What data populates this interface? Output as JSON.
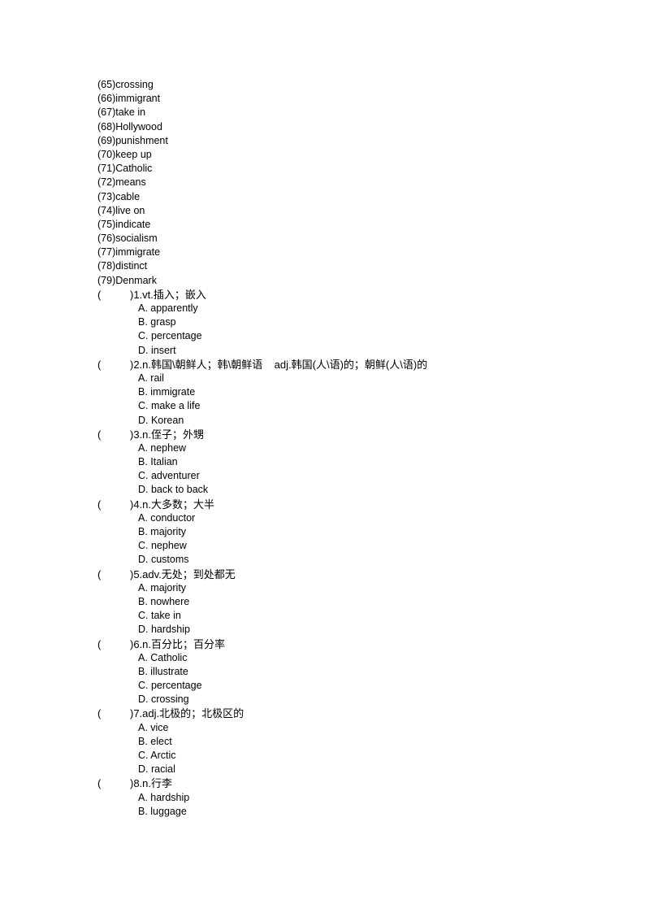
{
  "vocab_list": [
    {
      "num": "(65)",
      "word": "crossing"
    },
    {
      "num": "(66)",
      "word": "immigrant"
    },
    {
      "num": "(67)",
      "word": "take in"
    },
    {
      "num": "(68)",
      "word": "Hollywood"
    },
    {
      "num": "(69)",
      "word": "punishment"
    },
    {
      "num": "(70)",
      "word": "keep up"
    },
    {
      "num": "(71)",
      "word": "Catholic"
    },
    {
      "num": "(72)",
      "word": "means"
    },
    {
      "num": "(73)",
      "word": "cable"
    },
    {
      "num": "(74)",
      "word": "live on"
    },
    {
      "num": "(75)",
      "word": "indicate"
    },
    {
      "num": "(76)",
      "word": "socialism"
    },
    {
      "num": "(77)",
      "word": "immigrate"
    },
    {
      "num": "(78)",
      "word": "distinct"
    },
    {
      "num": "(79)",
      "word": "Denmark"
    }
  ],
  "questions": [
    {
      "open_paren": "(",
      "prompt": ")1.vt.插入；嵌入",
      "options": [
        "A. apparently",
        "B. grasp",
        "C. percentage",
        "D. insert"
      ]
    },
    {
      "open_paren": "(",
      "prompt": ")2.n.韩国\\朝鲜人；韩\\朝鲜语    adj.韩国(人\\语)的；朝鲜(人\\语)的",
      "options": [
        "A. rail",
        "B. immigrate",
        "C. make a life",
        "D. Korean"
      ]
    },
    {
      "open_paren": "(",
      "prompt": ")3.n.侄子；外甥",
      "options": [
        "A. nephew",
        "B. Italian",
        "C. adventurer",
        "D. back to back"
      ]
    },
    {
      "open_paren": "(",
      "prompt": ")4.n.大多数；大半",
      "options": [
        "A. conductor",
        "B. majority",
        "C. nephew",
        "D. customs"
      ]
    },
    {
      "open_paren": "(",
      "prompt": ")5.adv.无处；到处都无",
      "options": [
        "A. majority",
        "B. nowhere",
        "C. take in",
        "D. hardship"
      ]
    },
    {
      "open_paren": "(",
      "prompt": ")6.n.百分比；百分率",
      "options": [
        "A. Catholic",
        "B. illustrate",
        "C. percentage",
        "D. crossing"
      ]
    },
    {
      "open_paren": "(",
      "prompt": ")7.adj.北极的；北极区的",
      "options": [
        "A. vice",
        "B. elect",
        "C. Arctic",
        "D. racial"
      ]
    },
    {
      "open_paren": "(",
      "prompt": ")8.n.行李",
      "options": [
        "A. hardship",
        "B. luggage"
      ]
    }
  ]
}
